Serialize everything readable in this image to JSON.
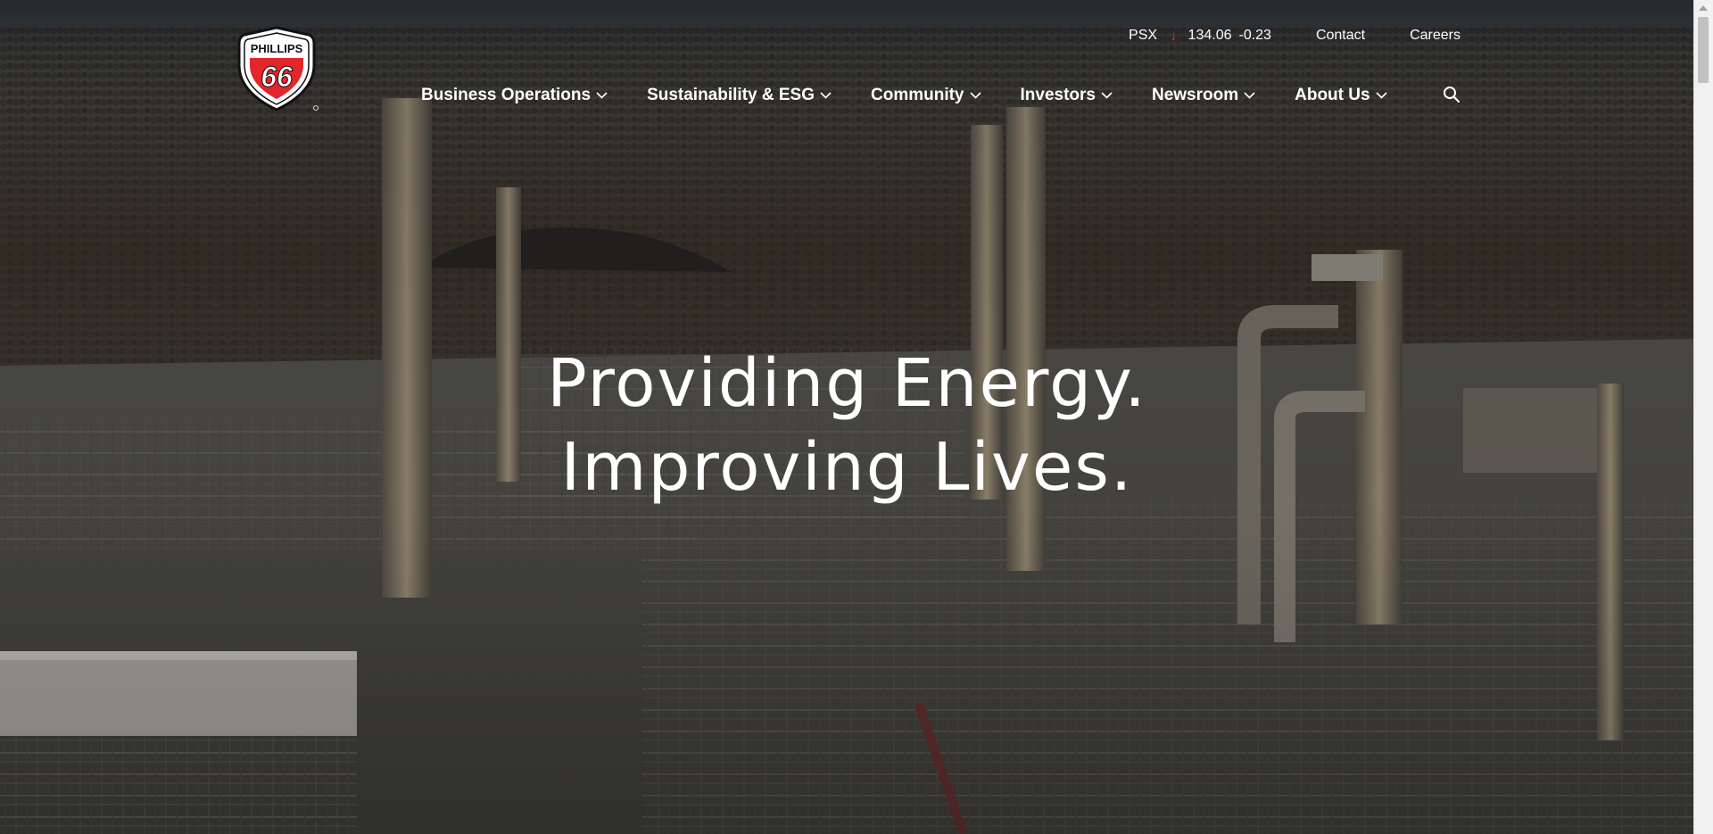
{
  "brand": {
    "logo_top": "PHILLIPS",
    "logo_number": "66",
    "colors": {
      "red": "#e3262b",
      "shield_outline": "#000000"
    }
  },
  "utility_nav": {
    "ticker_symbol": "PSX",
    "ticker_direction_icon": "arrow-down-icon",
    "ticker_price": "134.06",
    "ticker_change": "-0.23",
    "contact": "Contact",
    "careers": "Careers"
  },
  "main_nav": {
    "items": [
      {
        "label": "Business Operations"
      },
      {
        "label": "Sustainability & ESG"
      },
      {
        "label": "Community"
      },
      {
        "label": "Investors"
      },
      {
        "label": "Newsroom"
      },
      {
        "label": "About Us"
      }
    ],
    "search_icon": "search-icon"
  },
  "hero": {
    "line1": "Providing Energy.",
    "line2": "Improving Lives."
  }
}
